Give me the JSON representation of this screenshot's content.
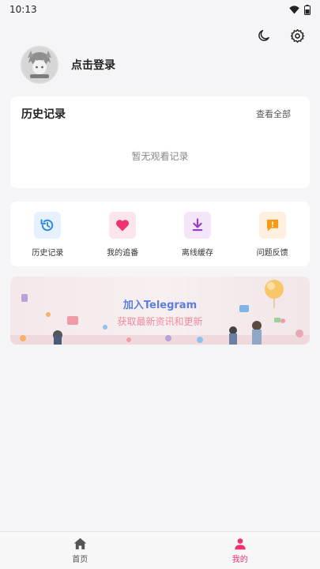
{
  "status_bar": {
    "time": "10:13"
  },
  "profile": {
    "login_label": "点击登录"
  },
  "history": {
    "title": "历史记录",
    "view_all": "查看全部",
    "empty": "暂无观看记录"
  },
  "shortcuts": [
    {
      "label": "历史记录",
      "icon": "history-icon",
      "bg": "#e6f1fd",
      "color": "#2f8ae6"
    },
    {
      "label": "我的追番",
      "icon": "heart-icon",
      "bg": "#fde5ec",
      "color": "#f0326e"
    },
    {
      "label": "离线缓存",
      "icon": "download-icon",
      "bg": "#f2e6f8",
      "color": "#9b3cc8"
    },
    {
      "label": "问题反馈",
      "icon": "feedback-icon",
      "bg": "#fdf0df",
      "color": "#f59a14"
    }
  ],
  "banner": {
    "title": "加入Telegram",
    "subtitle": "获取最新资讯和更新"
  },
  "bottom_nav": [
    {
      "label": "首页",
      "icon": "home-icon",
      "active": false
    },
    {
      "label": "我的",
      "icon": "user-icon",
      "active": true
    }
  ],
  "colors": {
    "accent": "#f0326e",
    "inactive": "#555555"
  }
}
